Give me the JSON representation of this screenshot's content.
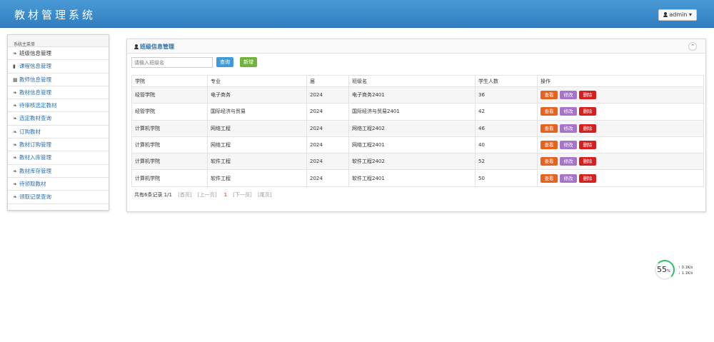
{
  "header": {
    "title": "教材管理系统",
    "user": "admin",
    "caret": "▾"
  },
  "sidebar": {
    "header": "系统主菜单",
    "items": [
      {
        "label": "班级信息管理",
        "icon": "leaf-icon",
        "glyph": "❧"
      },
      {
        "label": "课程信息管理",
        "icon": "bookmark-icon",
        "glyph": "▮"
      },
      {
        "label": "教师信息管理",
        "icon": "list-icon",
        "glyph": "▦"
      },
      {
        "label": "教材信息管理",
        "icon": "leaf-icon",
        "glyph": "❧"
      },
      {
        "label": "待审核选定教材",
        "icon": "leaf-icon",
        "glyph": "❧"
      },
      {
        "label": "选定教材查询",
        "icon": "leaf-icon",
        "glyph": "❧"
      },
      {
        "label": "订购教材",
        "icon": "leaf-icon",
        "glyph": "❧"
      },
      {
        "label": "教材订购管理",
        "icon": "leaf-icon",
        "glyph": "❧"
      },
      {
        "label": "教材入库管理",
        "icon": "leaf-icon",
        "glyph": "❧"
      },
      {
        "label": "教材库存管理",
        "icon": "leaf-icon",
        "glyph": "❧"
      },
      {
        "label": "待领取教材",
        "icon": "leaf-icon",
        "glyph": "❧"
      },
      {
        "label": "领取记录查询",
        "icon": "leaf-icon",
        "glyph": "❧"
      }
    ]
  },
  "panel": {
    "title": "班级信息管理",
    "collapse": "⌃",
    "search_placeholder": "请输入班级名",
    "query_label": "查询",
    "add_label": "新增"
  },
  "table": {
    "columns": [
      "学院",
      "专业",
      "届",
      "班级名",
      "学生人数",
      "操作"
    ],
    "rows": [
      [
        "经管学院",
        "电子商务",
        "2024",
        "电子商务2401",
        "36"
      ],
      [
        "经管学院",
        "国际经济与贸易",
        "2024",
        "国际经济与贸易2401",
        "42"
      ],
      [
        "计算机学院",
        "网络工程",
        "2024",
        "网络工程2402",
        "46"
      ],
      [
        "计算机学院",
        "网络工程",
        "2024",
        "网络工程2401",
        "40"
      ],
      [
        "计算机学院",
        "软件工程",
        "2024",
        "软件工程2402",
        "52"
      ],
      [
        "计算机学院",
        "软件工程",
        "2024",
        "软件工程2401",
        "50"
      ]
    ],
    "actions": {
      "view": "查看",
      "edit": "修改",
      "delete": "删除"
    }
  },
  "pager": {
    "summary": "共有6条记录 1/1",
    "first": "[首页]",
    "prev": "[上一页]",
    "current": "1",
    "next": "[下一页]",
    "last": "[尾页]"
  },
  "speed_widget": {
    "percent": "55",
    "percent_unit": "%",
    "up_arrow": "↑",
    "down_arrow": "↓",
    "upload": "0.1K/s",
    "download": "1.1K/s"
  }
}
